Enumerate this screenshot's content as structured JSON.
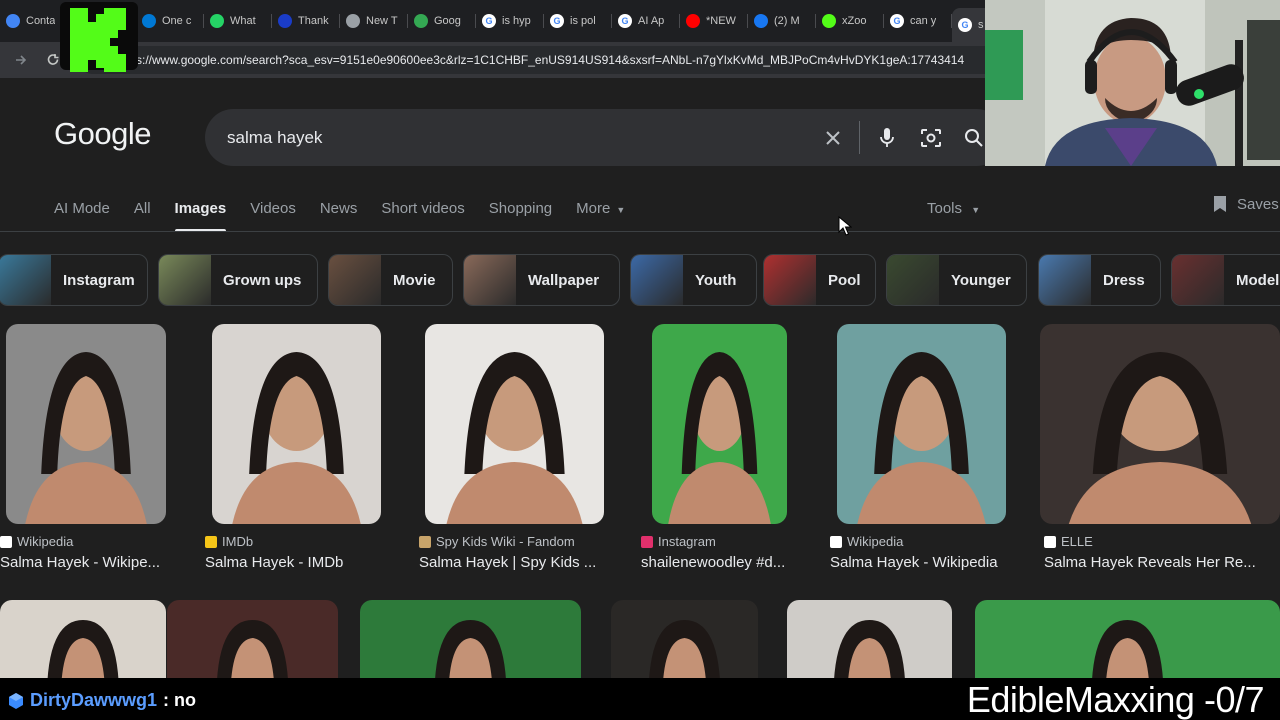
{
  "browser": {
    "tabs": [
      {
        "title": "Conta",
        "icon": "contacts-icon",
        "color": "#4285f4"
      },
      {
        "title": "",
        "icon": "blank-tab-icon",
        "color": "#3c4043"
      },
      {
        "title": "One c",
        "icon": "blank-tab-icon",
        "color": "#0078d4"
      },
      {
        "title": "What",
        "icon": "whatsapp-icon",
        "color": "#25d366"
      },
      {
        "title": "Thank",
        "icon": "meta-icon",
        "color": "#1a3cc8"
      },
      {
        "title": "New T",
        "icon": "chrome-icon",
        "color": "#9aa0a6"
      },
      {
        "title": "Goog",
        "icon": "google-drive-icon",
        "color": "#34a853"
      },
      {
        "title": "is hyp",
        "icon": "google-icon",
        "color": "#ffffff"
      },
      {
        "title": "is pol",
        "icon": "google-icon",
        "color": "#ffffff"
      },
      {
        "title": "AI Ap",
        "icon": "openai-icon",
        "color": "#ffffff"
      },
      {
        "title": "*NEW",
        "icon": "youtube-icon",
        "color": "#ff0000"
      },
      {
        "title": "(2) M",
        "icon": "facebook-icon",
        "color": "#1877f2"
      },
      {
        "title": "xZoo",
        "icon": "kick-icon",
        "color": "#53fc18"
      },
      {
        "title": "can y",
        "icon": "google-icon",
        "color": "#ffffff"
      },
      {
        "title": "s",
        "icon": "google-icon",
        "color": "#ffffff"
      }
    ],
    "url": "https://www.google.com/search?sca_esv=9151e0e90600ee3c&rlz=1C1CHBF_enUS914US914&sxsrf=ANbL-n7gYlxKvMd_MBJPoCm4vHvDYK1geA:17743414"
  },
  "google": {
    "logo_text": "Google",
    "query": "salma hayek",
    "nav_tabs": [
      "AI Mode",
      "All",
      "Images",
      "Videos",
      "News",
      "Short videos",
      "Shopping",
      "More"
    ],
    "active_tab": "Images",
    "tools_label": "Tools",
    "saves_label": "Saves"
  },
  "chips": [
    {
      "label": "Instagram",
      "color": "#3a7a9c"
    },
    {
      "label": "Grown ups",
      "color": "#7a8a5a"
    },
    {
      "label": "Movie",
      "color": "#6a5040"
    },
    {
      "label": "Wallpaper",
      "color": "#8a6a5a"
    },
    {
      "label": "Youth",
      "color": "#3c6aa8"
    },
    {
      "label": "Pool",
      "color": "#b03030"
    },
    {
      "label": "Younger",
      "color": "#3a4a30"
    },
    {
      "label": "Dress",
      "color": "#4a7ab0"
    },
    {
      "label": "Model",
      "color": "#6a3030"
    }
  ],
  "results": [
    {
      "source": "Wikipedia",
      "source_icon": "wikipedia-icon",
      "title": "Salma Hayek - Wikipe...",
      "bg": "#8a8a8a"
    },
    {
      "source": "IMDb",
      "source_icon": "imdb-icon",
      "title": "Salma Hayek - IMDb",
      "bg": "#d8d4d0"
    },
    {
      "source": "Spy Kids Wiki - Fandom",
      "source_icon": "fandom-icon",
      "title": "Salma Hayek | Spy Kids ...",
      "bg": "#e8e6e3"
    },
    {
      "source": "Instagram",
      "source_icon": "instagram-icon",
      "title": "shailenewoodley #d...",
      "bg": "#3ea84a"
    },
    {
      "source": "Wikipedia",
      "source_icon": "wikipedia-icon",
      "title": "Salma Hayek - Wikipedia",
      "bg": "#6fa0a0"
    },
    {
      "source": "ELLE",
      "source_icon": "elle-icon",
      "title": "Salma Hayek Reveals Her Re...",
      "bg": "#3a3230"
    }
  ],
  "overlay": {
    "chat_user": "DirtyDawwwg1",
    "chat_sep": ":",
    "chat_message": "no",
    "counter_text": "EdibleMaxxing -0/7"
  }
}
